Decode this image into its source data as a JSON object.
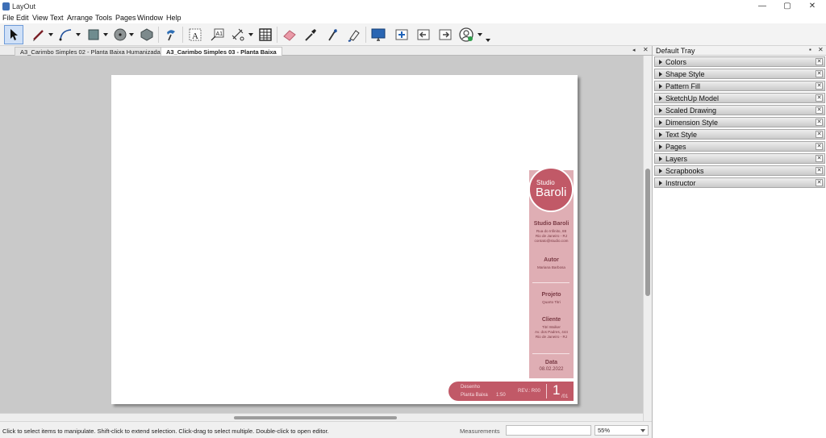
{
  "window": {
    "title": "LayOut",
    "controls": {
      "minimize": "—",
      "maximize": "▢",
      "close": "✕"
    }
  },
  "menu": [
    "File",
    "Edit",
    "View",
    "Text",
    "Arrange",
    "Tools",
    "Pages",
    "Window",
    "Help"
  ],
  "toolbar": {
    "tools": [
      "select-arrow-icon",
      "pencil-line-icon",
      "arc-icon",
      "rectangle-icon",
      "circle-icon",
      "polygon-icon",
      "style-brush-icon",
      "text-icon",
      "label-icon",
      "dimension-icon",
      "table-icon",
      "eraser-icon",
      "eyedropper-icon",
      "split-icon",
      "join-icon",
      "presentation-icon",
      "add-page-icon",
      "previous-page-icon",
      "next-page-icon",
      "account-icon"
    ],
    "colors": {
      "accent": "#3d6fb6",
      "active_bg": "#cfe0f7"
    }
  },
  "tabs": [
    {
      "label": "A3_Carimbo Simples 02 - Planta Baixa Humanizada",
      "active": false
    },
    {
      "label": "A3_Carimbo Simples 03 - Planta Baixa",
      "active": true
    }
  ],
  "tab_close": "✕",
  "document": {
    "logo": {
      "studio": "Studio",
      "name": "Baroli"
    },
    "office": {
      "name": "Studio Baroli",
      "lines": [
        "Rua do Infinito, 88",
        "Rio de Janeiro - RJ",
        "contato@studio.com"
      ]
    },
    "author": {
      "heading": "Autor",
      "name": "Mariana Barbosa"
    },
    "project": {
      "heading": "Projeto",
      "name": "Quarto Titri"
    },
    "client": {
      "heading": "Cliente",
      "lines": [
        "Titri Walker",
        "Av. dos Padres, 444",
        "Rio de Janeiro - RJ"
      ]
    },
    "date": {
      "heading": "Data",
      "value": "08.02.2022"
    },
    "bottom": {
      "drawing_label": "Desenho",
      "drawing_name": "Planta Baixa",
      "scale": "1:50",
      "revision": "REV.: R00",
      "sheet_number": "1",
      "sheet_total": "/01"
    },
    "colors": {
      "primary": "#c15967",
      "light": "#dfaeb4"
    }
  },
  "tray": {
    "title": "Default Tray",
    "pin": "▪",
    "close": "✕",
    "panels": [
      "Colors",
      "Shape Style",
      "Pattern Fill",
      "SketchUp Model",
      "Scaled Drawing",
      "Dimension Style",
      "Text Style",
      "Pages",
      "Layers",
      "Scrapbooks",
      "Instructor"
    ]
  },
  "status": {
    "message": "Click to select items to manipulate. Shift-click to extend selection. Click-drag to select multiple. Double-click to open editor.",
    "measurements_label": "Measurements",
    "measurements_value": "",
    "zoom": "55%"
  }
}
